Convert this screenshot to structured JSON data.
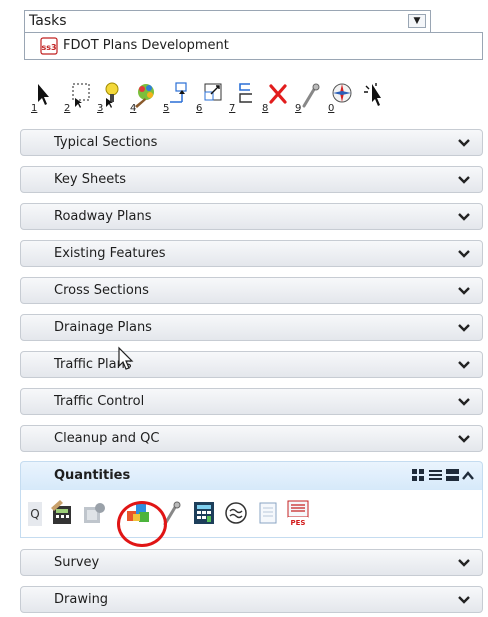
{
  "tasks": {
    "title": "Tasks"
  },
  "workflow": {
    "label": "FDOT Plans Development"
  },
  "toolbar": {
    "tools": [
      {
        "icon": "element-selection-arrow-icon",
        "shortcut": "1"
      },
      {
        "icon": "fence-select-icon",
        "shortcut": "2"
      },
      {
        "icon": "analyze-element-icon",
        "shortcut": "3"
      },
      {
        "icon": "paint-element-icon",
        "shortcut": "4"
      },
      {
        "icon": "move-element-icon",
        "shortcut": "5"
      },
      {
        "icon": "scale-element-icon",
        "shortcut": "6"
      },
      {
        "icon": "offset-element-icon",
        "shortcut": "7"
      },
      {
        "icon": "delete-element-icon",
        "shortcut": "8"
      },
      {
        "icon": "measure-distance-icon",
        "shortcut": "9"
      },
      {
        "icon": "compass-rotate-icon",
        "shortcut": "0"
      },
      {
        "icon": "spark-pointer-icon",
        "shortcut": ""
      }
    ]
  },
  "sections": [
    {
      "label": "Typical Sections"
    },
    {
      "label": "Key Sheets"
    },
    {
      "label": "Roadway Plans"
    },
    {
      "label": "Existing Features"
    },
    {
      "label": "Cross Sections"
    },
    {
      "label": "Drainage Plans"
    },
    {
      "label": "Traffic Plans"
    },
    {
      "label": "Traffic Control"
    },
    {
      "label": "Cleanup and QC"
    }
  ],
  "quantities": {
    "label": "Quantities",
    "search_letter": "Q",
    "tools": [
      {
        "icon": "pay-item-calculator-icon"
      },
      {
        "icon": "quantity-manager-icon"
      },
      {
        "icon": "colored-cubes-icon"
      },
      {
        "icon": "quantity-measure-icon"
      },
      {
        "icon": "spreadsheet-calculator-icon"
      },
      {
        "icon": "approximate-quantity-icon"
      },
      {
        "icon": "document-report-icon"
      },
      {
        "icon": "pes-report-icon"
      }
    ],
    "pes_text": "PES"
  },
  "bottom_sections": [
    {
      "label": "Survey"
    },
    {
      "label": "Drawing"
    }
  ],
  "colors": {
    "highlight_circle": "#e01515",
    "active_header": "#d6e9fa",
    "border": "#9aa6b4"
  }
}
